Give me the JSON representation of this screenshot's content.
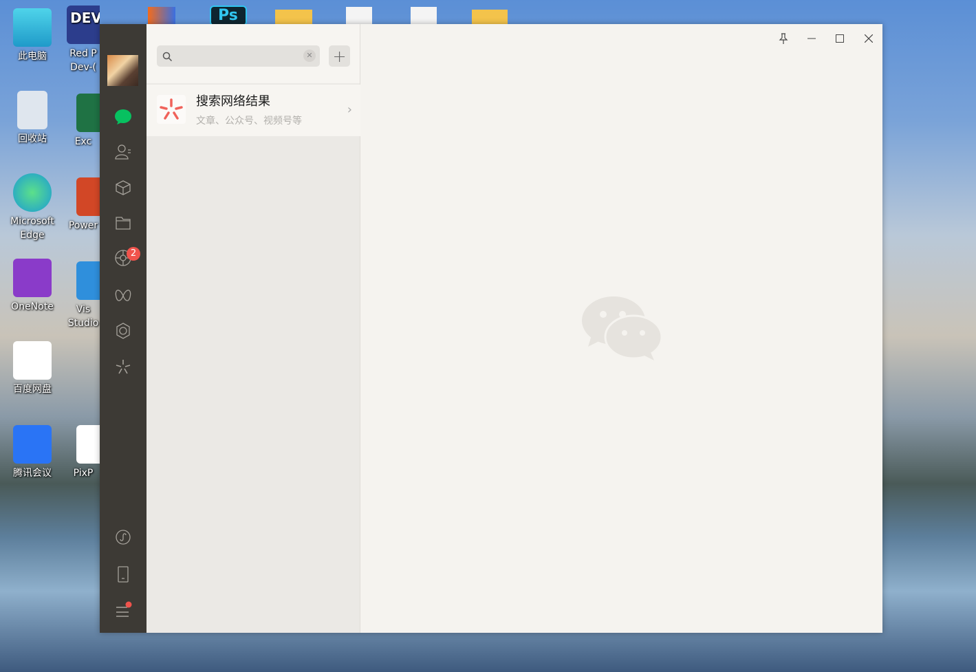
{
  "desktop": {
    "icons": [
      {
        "label": "此电脑",
        "color": "#3ec6e0"
      },
      {
        "label": "Red P\nDev-(",
        "color": "#2c3d8c"
      },
      {
        "label": "回收站",
        "color": "#dfe6ee"
      },
      {
        "label": "Exc",
        "color": "#1f7244"
      },
      {
        "label": "Microsoft Edge",
        "color": "#1a9ad6"
      },
      {
        "label": "Power",
        "color": "#d24726"
      },
      {
        "label": "OneNote",
        "color": "#8a3bc9"
      },
      {
        "label": "Vis\nStudio",
        "color": "#2f8fdc"
      },
      {
        "label": "百度网盘",
        "color": "#ffffff"
      },
      {
        "label": "腾讯会议",
        "color": "#2a74f5"
      },
      {
        "label": "PixP",
        "color": "#ffffff"
      }
    ],
    "top_icons": [
      "DEV",
      "Ps"
    ]
  },
  "sidebar": {
    "items": [
      "chats",
      "contacts",
      "favorites",
      "files",
      "moments",
      "channels",
      "mini-programs",
      "search"
    ],
    "moments_badge": "2",
    "bottom": [
      "mini-program-panel",
      "phone",
      "menu"
    ]
  },
  "search": {
    "placeholder": ""
  },
  "result": {
    "title": "搜索网络结果",
    "subtitle": "文章、公众号、视频号等"
  },
  "colors": {
    "accent": "#07c160",
    "badge": "#f0534c",
    "sidebar": "#3d3a35"
  }
}
